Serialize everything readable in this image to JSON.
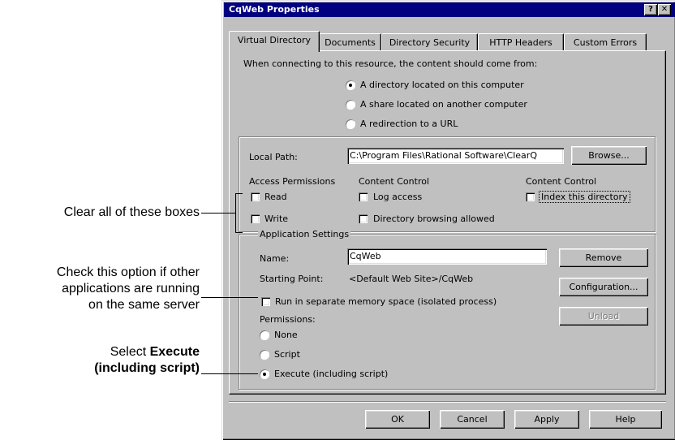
{
  "window": {
    "title": "CqWeb Properties",
    "help_btn": "?",
    "close_btn": "✕"
  },
  "tabs": [
    {
      "label": "Virtual Directory",
      "active": true
    },
    {
      "label": "Documents"
    },
    {
      "label": "Directory Security"
    },
    {
      "label": "HTTP Headers"
    },
    {
      "label": "Custom Errors"
    }
  ],
  "content_source": {
    "prompt": "When connecting to this resource, the content should come from:",
    "options": [
      {
        "label": "A directory located on this computer",
        "selected": true
      },
      {
        "label": "A share located on another computer"
      },
      {
        "label": "A redirection to a URL"
      }
    ]
  },
  "local_path": {
    "label": "Local Path:",
    "value": "C:\\Program Files\\Rational Software\\ClearQ",
    "browse_label": "Browse..."
  },
  "access_permissions": {
    "heading": "Access Permissions",
    "read": "Read",
    "write": "Write"
  },
  "content_control_1": {
    "heading": "Content Control",
    "log_access": "Log access",
    "dir_browsing": "Directory browsing allowed"
  },
  "content_control_2": {
    "heading": "Content Control",
    "index_dir": "Index this directory"
  },
  "app_settings": {
    "heading": "Application Settings",
    "name_label": "Name:",
    "name_value": "CqWeb",
    "remove_label": "Remove",
    "starting_point_label": "Starting Point:",
    "starting_point_value": "<Default Web Site>/CqWeb",
    "configuration_label": "Configuration...",
    "separate_memory": "Run in separate memory space (isolated process)",
    "unload_label": "Unload",
    "permissions_label": "Permissions:",
    "perm_none": "None",
    "perm_script": "Script",
    "perm_execute": "Execute (including script)"
  },
  "footer": {
    "ok": "OK",
    "cancel": "Cancel",
    "apply": "Apply",
    "help": "Help"
  },
  "callouts": {
    "clear_boxes": "Clear all of these boxes",
    "check_option_1": "Check this option if other",
    "check_option_2": "applications are running",
    "check_option_3": "on the same server",
    "select_prefix": "Select ",
    "select_bold_1": "Execute",
    "select_bold_2": "(including script)"
  }
}
